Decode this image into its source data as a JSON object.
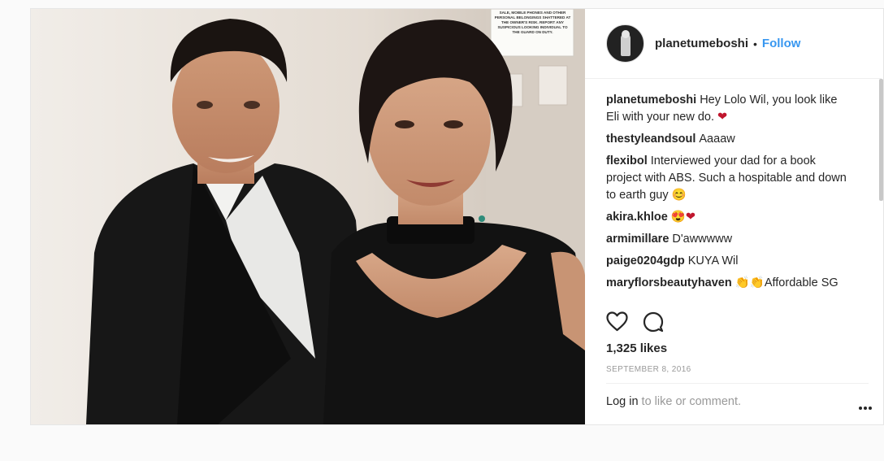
{
  "post": {
    "author": "planetumeboshi",
    "separator": "•",
    "follow_label": "Follow",
    "comments": [
      {
        "user": "planetumeboshi",
        "text": "Hey Lolo Wil, you look like Eli with your new do.",
        "emoji": "❤"
      },
      {
        "user": "thestyleandsoul",
        "text": "Aaaaw",
        "emoji": ""
      },
      {
        "user": "flexibol",
        "text": "Interviewed your dad for a book project with ABS. Such a hospitable and down to earth guy",
        "emoji": "😊"
      },
      {
        "user": "akira.khloe",
        "text": "",
        "emoji": "😍❤"
      },
      {
        "user": "armimillare",
        "text": "D'awwwww",
        "emoji": ""
      },
      {
        "user": "paige0204gdp",
        "text": "KUYA Wil",
        "emoji": ""
      },
      {
        "user": "maryflorsbeautyhaven",
        "text": "👏👏Affordable SG",
        "emoji": ""
      }
    ],
    "likes": "1,325 likes",
    "date": "SEPTEMBER 8, 2016",
    "login_link": "Log in",
    "login_rest": " to like or comment.",
    "poster_text": "SALE, MOBILE PHONES AND OTHER PERSONAL BELONGINGS SHATTERED AT THE OWNER'S RISK. REPORT ANY SUSPICIOUS LOOKING INDIVIDUAL TO THE GUARD ON DUTY."
  },
  "icons": {
    "avatar": "profile-avatar",
    "like": "heart-outline-icon",
    "comment": "speech-bubble-icon",
    "more": "more-options-icon"
  },
  "colors": {
    "accent": "#3897f0",
    "text": "#262626",
    "muted": "#999999",
    "heart": "#c0152d"
  }
}
